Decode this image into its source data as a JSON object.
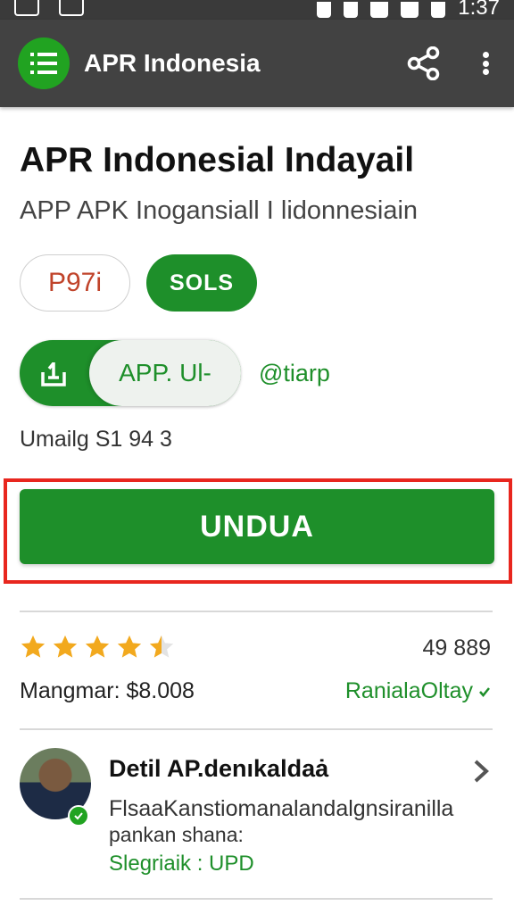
{
  "status_bar": {
    "time": "1:37",
    "icons": [
      "image-icon",
      "tools-icon",
      "mute-icon",
      "alarm-icon",
      "wifi-icon",
      "signal-icon",
      "battery-icon"
    ]
  },
  "app_bar": {
    "title": "APR Indonesia",
    "logo_icon": "list-icon",
    "actions": [
      "share-icon",
      "more-vert-icon"
    ]
  },
  "app": {
    "title": "APR Indonesial Indayail",
    "subtitle": "APP APK Inogansiall I lidonnesiain",
    "chips": {
      "outline": "P97i",
      "green": "SOLS"
    },
    "toggle_label": "APP. Ul‑",
    "developer_handle": "@tiarp",
    "update_text": "Umailg S1 94 3",
    "download_label": "UNDUA"
  },
  "rating": {
    "stars": 4.5,
    "count": "49 889",
    "price_text": "Mangmar: $8.008",
    "verified_text": "RanialaOltay"
  },
  "developer_card": {
    "title": "Detil AP.denıkaldaȧ",
    "description": "FlsaaKanstiomanalandalgnsiranilla",
    "description_line2": "pankan shana:",
    "meta": "Slegriaik : UPD"
  },
  "colors": {
    "primary_green": "#1e8f2a",
    "app_bar": "#424242",
    "highlight_red": "#e8261e",
    "star_gold": "#f2a91e",
    "chip_text_red": "#c0432a"
  }
}
